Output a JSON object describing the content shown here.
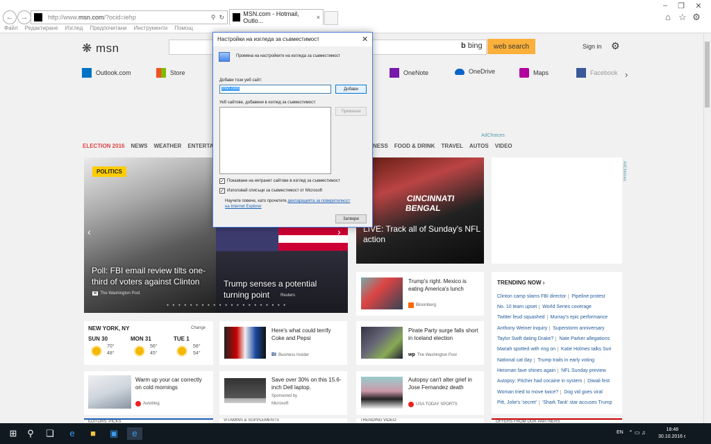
{
  "browser": {
    "address_prefix": "http://www.",
    "address_domain": "msn.com",
    "address_suffix": "/?ocid=iehp",
    "tab_title": "MSN.com - Hotmail, Outlo...",
    "menus": [
      "Файл",
      "Редактиране",
      "Изглед",
      "Предпочитани",
      "Инструменти",
      "Помощ"
    ]
  },
  "page": {
    "logo": "msn",
    "bing": "bing",
    "web_search": "web search",
    "sign_in": "Sign in",
    "quick_links": [
      "Outlook.com",
      "Store",
      "OneNote",
      "OneDrive",
      "Maps",
      "Facebook"
    ],
    "adchoices": "AdChoices",
    "categories": [
      "ELECTION 2016",
      "NEWS",
      "WEATHER",
      "ENTERTA",
      "NESS",
      "FOOD & DRINK",
      "TRAVEL",
      "AUTOS",
      "VIDEO"
    ],
    "hero": {
      "badge": "POLITICS",
      "left_title": "Poll: FBI email review tilts one-third of voters against Clinton",
      "left_source": "The Washington Post",
      "right_title": "Trump senses a potential turning point",
      "right_source": "Reuters"
    },
    "nfl_title": "LIVE: Track all of Sunday's NFL action",
    "nfl_sign": "CINCINNATI BENGAL",
    "ad_label": "AdChoices",
    "cards": [
      {
        "title": "Trump's right. Mexico is eating America's lunch",
        "source": "Bloomberg"
      },
      {
        "title": "Here's what could terrify Coke and Pepsi",
        "source": "Business Insider"
      },
      {
        "title": "Pirate Party surge falls short in Iceland election",
        "source": "The Washington Post"
      },
      {
        "title": "Warm up your car correctly on cold mornings",
        "source": "Autoblog"
      },
      {
        "title": "Save over 30% on this 15.6-inch Dell laptop.",
        "source": "Sponsored by",
        "source2": "Microsoft"
      },
      {
        "title": "Autopsy can't alter grief in Jose Fernandez death",
        "source": "USA TODAY SPORTS"
      }
    ],
    "weather": {
      "city": "NEW YORK, NY",
      "change": "Change",
      "days": [
        {
          "day": "SUN 30",
          "high": "70°",
          "low": "48°"
        },
        {
          "day": "MON 31",
          "high": "56°",
          "low": "45°"
        },
        {
          "day": "TUE 1",
          "high": "58°",
          "low": "54°"
        }
      ]
    },
    "trending": {
      "header": "TRENDING NOW",
      "rows": [
        [
          "Clinton camp slams FBI director",
          "Pipeline protest"
        ],
        [
          "No. 10 team upset",
          "World Series coverage"
        ],
        [
          "Twitter feud squashed",
          "Murray's epic performance"
        ],
        [
          "Anthony Weiner inquiry",
          "Superstorm anniversary"
        ],
        [
          "Taylor Swift dating Drake?",
          "Nate Parker allegations"
        ],
        [
          "Mariah spotted with ring on",
          "Katie Holmes talks Suri"
        ],
        [
          "National cat day",
          "Trump trails in early voting"
        ],
        [
          "Heisman fave shines again",
          "NFL Sunday preview"
        ],
        [
          "Autopsy: Pitcher had cocaine in system",
          "Diwali fest"
        ],
        [
          "Woman tried to move twice?",
          "Dog vid goes viral"
        ],
        [
          "Pitt, Jolie's 'secret'",
          "'Shark Tank' star accuses Trump"
        ]
      ]
    },
    "strips": [
      "EDITORS' PICKS",
      "VITAMINS & SUPPLEMENTS",
      "TRENDING VIDEO",
      "OFFERS FROM OUR PARTNERS"
    ]
  },
  "dialog": {
    "title": "Настройки на изгледа за съвместимост",
    "info": "Промяна на настройките на изгледа за съвместимост",
    "add_label": "Добави този уеб сайт:",
    "add_value": "msn.com",
    "add_button": "Добави",
    "list_label": "Уеб сайтове, добавени в изглед за съвместимост:",
    "remove_button": "Премахни",
    "chk1": "Показване на интранет сайтове в изглед за съвместимост",
    "chk2": "Използвай списъци за съвместимост от Microsoft",
    "learn_prefix": "Научете повече, като прочетете ",
    "learn_link": "декларацията за поверителност",
    "learn_link2": "на Internet Explorer",
    "close_button": "Затвори"
  },
  "taskbar": {
    "lang": "EN",
    "time": "18:48",
    "date": "30.10.2016 г."
  },
  "colors": {
    "accent": "#fbb03b",
    "badge": "#ffcc00",
    "link": "#225b9a",
    "election": "#dd4444"
  }
}
